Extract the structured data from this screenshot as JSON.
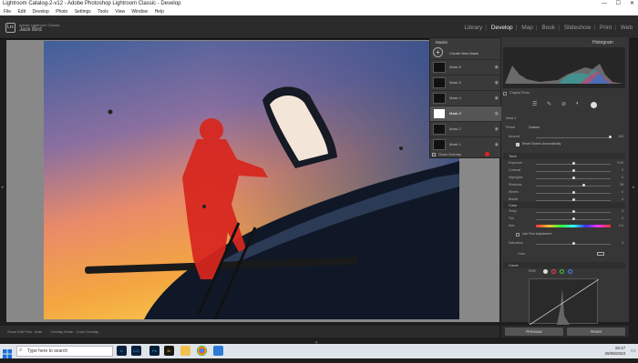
{
  "window": {
    "title": "Lightroom Catalog-2-v12 - Adobe Photoshop Lightroom Classic - Develop",
    "controls": [
      "—",
      "☐",
      "✕"
    ]
  },
  "menu": [
    "File",
    "Edit",
    "Develop",
    "Photo",
    "Settings",
    "Tools",
    "View",
    "Window",
    "Help"
  ],
  "identity": {
    "logo": "Lrc",
    "line1": "Adobe Lightroom Classic",
    "line2": "Jack Bird"
  },
  "modules": [
    "Library",
    "Develop",
    "Map",
    "Book",
    "Slideshow",
    "Print",
    "Web"
  ],
  "active_module": "Develop",
  "masks_panel": {
    "title": "Masks",
    "create_label": "Create New Mask",
    "masks": [
      "Mask 6",
      "Mask 5",
      "Mask 4",
      "Mask 3",
      "Mask 2",
      "Mask 1"
    ],
    "selected": "Mask 3",
    "show_overlay": "Show Overlay"
  },
  "right_panel": {
    "header": "Histogram",
    "original_photo": "Original Photo",
    "mask_name": "Mask 3",
    "preset_label": "Preset",
    "preset_value": "Custom",
    "amount_label": "Amount",
    "amount_value": "100",
    "reset_label": "Reset Sliders Automatically",
    "tone_header": "Tone",
    "tone": [
      {
        "label": "Exposure",
        "value": "0.00",
        "pos": 0.5
      },
      {
        "label": "Contrast",
        "value": "0",
        "pos": 0.5
      },
      {
        "label": "Highlights",
        "value": "0",
        "pos": 0.5
      },
      {
        "label": "Shadows",
        "value": "28",
        "pos": 0.64
      },
      {
        "label": "Whites",
        "value": "0",
        "pos": 0.5
      },
      {
        "label": "Blacks",
        "value": "0",
        "pos": 0.5
      }
    ],
    "color_header": "Color",
    "color": [
      {
        "label": "Temp",
        "value": "0",
        "pos": 0.5
      },
      {
        "label": "Tint",
        "value": "0",
        "pos": 0.5
      },
      {
        "label": "Hue",
        "value": "0.0",
        "pos": 0.5
      }
    ],
    "fine_adjust": "Use Fine Adjustment",
    "saturation": {
      "label": "Saturation",
      "value": "0",
      "pos": 0.5
    },
    "color_label": "Color",
    "curve_header": "Curve",
    "curve_channel": "RGB",
    "previous_button": "Previous",
    "reset_button": "Reset"
  },
  "bottom_toolbar": {
    "items": [
      "Show Edit Pins : Auto",
      "Overlay Mode : Color Overlay"
    ]
  },
  "taskbar": {
    "search_placeholder": "Type here to search",
    "apps": [
      "Lr",
      "LrC",
      "Ps",
      "Br",
      "",
      "",
      ""
    ],
    "time": "19:17",
    "date": "29/08/2023"
  }
}
